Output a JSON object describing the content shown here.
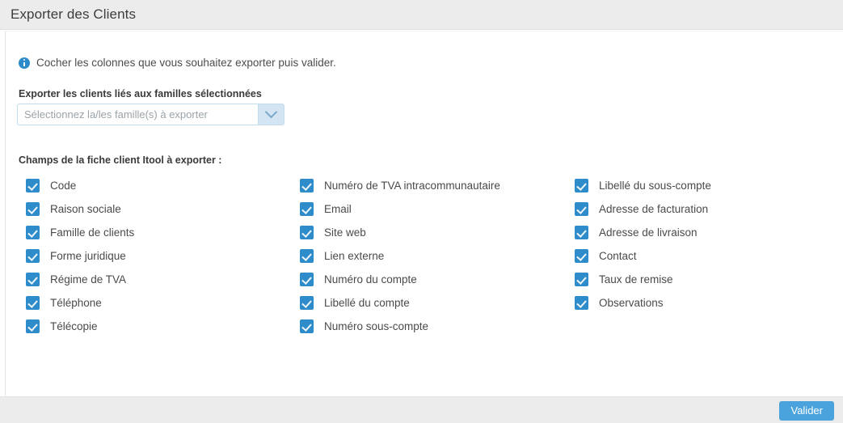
{
  "header": {
    "title": "Exporter des Clients"
  },
  "info": {
    "icon": "info-circle-icon",
    "text": "Cocher les colonnes que vous souhaitez exporter puis valider."
  },
  "family_selector": {
    "label": "Exporter les clients liés aux familles sélectionnées",
    "value": "",
    "placeholder": "Sélectionnez la/les famille(s) à exporter",
    "toggle_icon": "chevron-down-icon"
  },
  "fields_section": {
    "label": "Champs de la fiche client Itool à exporter :",
    "columns": [
      {
        "items": [
          {
            "label": "Code",
            "checked": true
          },
          {
            "label": "Raison sociale",
            "checked": true
          },
          {
            "label": "Famille de clients",
            "checked": true
          },
          {
            "label": "Forme juridique",
            "checked": true
          },
          {
            "label": "Régime de TVA",
            "checked": true
          },
          {
            "label": "Téléphone",
            "checked": true
          },
          {
            "label": "Télécopie",
            "checked": true
          }
        ]
      },
      {
        "items": [
          {
            "label": "Numéro de TVA intracommunautaire",
            "checked": true
          },
          {
            "label": "Email",
            "checked": true
          },
          {
            "label": "Site web",
            "checked": true
          },
          {
            "label": "Lien externe",
            "checked": true
          },
          {
            "label": "Numéro du compte",
            "checked": true
          },
          {
            "label": "Libellé du compte",
            "checked": true
          },
          {
            "label": "Numéro sous-compte",
            "checked": true
          }
        ]
      },
      {
        "items": [
          {
            "label": "Libellé du sous-compte",
            "checked": true
          },
          {
            "label": "Adresse de facturation",
            "checked": true
          },
          {
            "label": "Adresse de livraison",
            "checked": true
          },
          {
            "label": "Contact",
            "checked": true
          },
          {
            "label": "Taux de remise",
            "checked": true
          },
          {
            "label": "Observations",
            "checked": true
          }
        ]
      }
    ]
  },
  "footer": {
    "validate_label": "Valider"
  },
  "colors": {
    "accent": "#2f8ccb",
    "button": "#4ba3dd",
    "header_bg": "#ececec",
    "info_icon": "#2e8bc9"
  }
}
